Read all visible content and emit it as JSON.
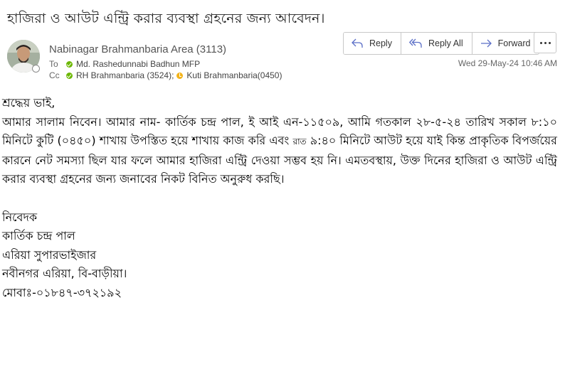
{
  "subject": "হাজিরা ও আউট এন্ট্রি করার ব্যবস্থা গ্রহনের জন্য আবেদন।",
  "sender": {
    "name": "Nabinagar Brahmanbaria Area (3113)"
  },
  "to": {
    "label": "To",
    "recipients": [
      {
        "name": "Md. Rashedunnabi Badhun MFP",
        "status": "available",
        "color": "#6bb700"
      }
    ]
  },
  "cc": {
    "label": "Cc",
    "recipients": [
      {
        "name": "RH Brahmanbaria (3524);",
        "status": "available",
        "color": "#6bb700"
      },
      {
        "name": "Kuti Brahmanbaria(0450)",
        "status": "away",
        "color": "#f3b31a"
      }
    ]
  },
  "actions": {
    "reply": "Reply",
    "reply_all": "Reply All",
    "forward": "Forward",
    "more_icon": "more-icon"
  },
  "datetime": "Wed 29-May-24 10:46 AM",
  "body": {
    "salutation": "শ্রদ্ধেয় ভাই,",
    "paragraph_start": "আমার সালাম নিবেন। আমার নাম- কার্তিক চন্দ্র পাল, ই আই এন-১১৫০৯, আমি গতকাল ২৮-৫-২৪ তারিখ সকাল ৮:১০ মিনিটে কুটি (০৪৫০) শাখায় উপস্তিত হয়ে শাখায় কাজ করি এবং",
    "paragraph_small": "রাত",
    "paragraph_end": "৯:৪০ মিনিটে আউট হয়ে যাই কিন্ত প্রাকৃতিক বিপর্জয়ের কারনে নেট সমস্যা ছিল যার ফলে আমার হাজিরা এন্ট্রি দেওয়া সম্ভব হয় নি। এমতবস্থায়, উক্ত দিনের হাজিরা ও আউট এন্ট্রি করার ব্যবস্থা গ্রহনের জন্য জনাবের নিকট বিনিত অনুরুধ করছি।",
    "signature": [
      "নিবেদক",
      "কার্তিক চন্দ্র পাল",
      "এরিয়া সুপারভাইজার",
      "নবীনগর এরিয়া, বি-বাড়ীয়া।",
      "মোবাঃ-০১৮৪৭-৩৭২১৯২"
    ]
  },
  "colors": {
    "accent": "#5b6fc7",
    "available": "#6bb700",
    "away": "#f3b31a"
  }
}
